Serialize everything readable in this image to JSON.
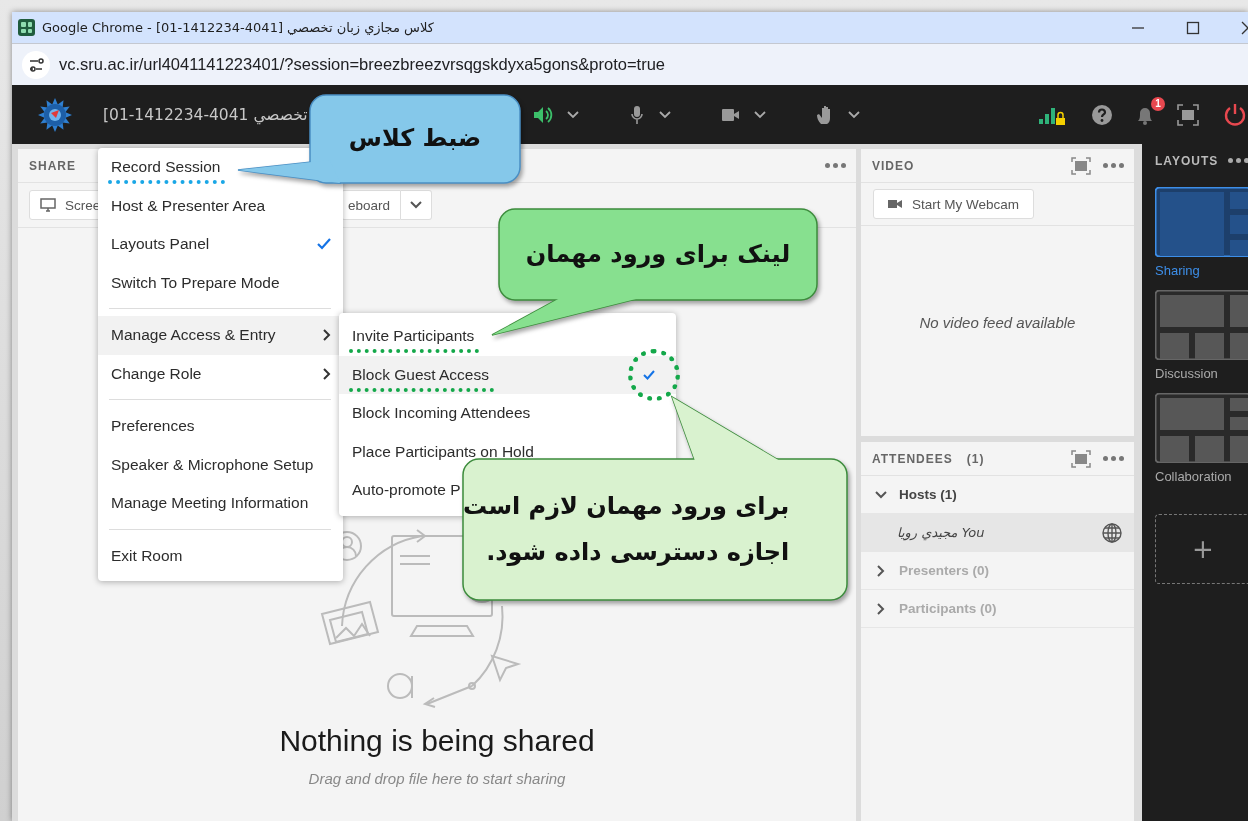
{
  "browser": {
    "title": "Google Chrome - [01-1412234-4041] كلاس مجازي زبان تخصصي",
    "url": "vc.sru.ac.ir/url4041141223401/?session=breezbreezvrsqgskdyxa5gons&proto=true"
  },
  "app_bar": {
    "meeting_title": "[01-1412234-4041 تخصصي",
    "notification_count": "1"
  },
  "share_pod": {
    "title": "SHARE",
    "buttons": [
      {
        "label": "Scree",
        "kind": "screen"
      },
      {
        "label": "eboard",
        "kind": "whiteboard"
      }
    ],
    "empty_title": "Nothing is being shared",
    "empty_hint": "Drag and drop file here to start sharing"
  },
  "menu": {
    "items": [
      {
        "kind": "item",
        "label": "Record Session",
        "checked": false,
        "highlighted": false,
        "marked": true
      },
      {
        "kind": "item",
        "label": "Host & Presenter Area",
        "checked": false,
        "highlighted": false,
        "marked": false
      },
      {
        "kind": "item",
        "label": "Layouts Panel",
        "checked": true,
        "highlighted": false,
        "marked": false
      },
      {
        "kind": "item",
        "label": "Switch To Prepare Mode",
        "checked": false,
        "highlighted": false,
        "marked": false
      },
      {
        "kind": "divider"
      },
      {
        "kind": "submenu",
        "label": "Manage Access & Entry",
        "checked": false,
        "highlighted": true,
        "marked": false
      },
      {
        "kind": "submenu",
        "label": "Change Role",
        "checked": false,
        "highlighted": false,
        "marked": false
      },
      {
        "kind": "divider"
      },
      {
        "kind": "item",
        "label": "Preferences",
        "checked": false,
        "highlighted": false,
        "marked": false
      },
      {
        "kind": "item",
        "label": "Speaker & Microphone Setup",
        "checked": false,
        "highlighted": false,
        "marked": false
      },
      {
        "kind": "item",
        "label": "Manage Meeting Information",
        "checked": false,
        "highlighted": false,
        "marked": false
      },
      {
        "kind": "divider"
      },
      {
        "kind": "item",
        "label": "Exit Room",
        "checked": false,
        "highlighted": false,
        "marked": false
      }
    ]
  },
  "submenu": {
    "items": [
      {
        "label": "Invite Participants",
        "checked": false,
        "highlighted": false,
        "marked": true,
        "circled": false
      },
      {
        "label": "Block Guest Access",
        "checked": true,
        "highlighted": true,
        "marked": true,
        "circled": true
      },
      {
        "label": "Block Incoming Attendees",
        "checked": false,
        "highlighted": false,
        "marked": false,
        "circled": false
      },
      {
        "label": "Place Participants on Hold",
        "checked": false,
        "highlighted": false,
        "marked": false,
        "circled": false
      },
      {
        "label": "Auto-promote P",
        "checked": false,
        "highlighted": false,
        "marked": false,
        "circled": false
      }
    ]
  },
  "callouts": [
    {
      "kind": "left",
      "color": "#85c8ea",
      "lines": [
        "ضبط کلاس"
      ]
    },
    {
      "kind": "below",
      "color": "#87e08f",
      "lines": [
        "لینک برای ورود مهمان"
      ]
    },
    {
      "kind": "above",
      "color": "#d9f2cf",
      "lines": [
        "برای ورود مهمان لازم است",
        "اجازه دسترسی داده شود."
      ]
    }
  ],
  "video_pod": {
    "title": "VIDEO",
    "button": "Start My Webcam",
    "empty": "No video feed available"
  },
  "attendees_pod": {
    "title": "ATTENDEES",
    "count": "(1)",
    "groups": [
      {
        "label": "Hosts (1)",
        "expanded": true,
        "disabled": false,
        "children": [
          {
            "name": "مجيدي رويا You",
            "selected": true
          }
        ]
      },
      {
        "label": "Presenters (0)",
        "expanded": false,
        "disabled": true
      },
      {
        "label": "Participants (0)",
        "expanded": false,
        "disabled": true
      }
    ]
  },
  "layouts": {
    "title": "LAYOUTS",
    "items": [
      {
        "label": "Sharing",
        "kind": "sharing",
        "selected": true
      },
      {
        "label": "Discussion",
        "kind": "discussion",
        "selected": false
      },
      {
        "label": "Collaboration",
        "kind": "collaboration",
        "selected": false
      }
    ],
    "add_label": "+"
  }
}
